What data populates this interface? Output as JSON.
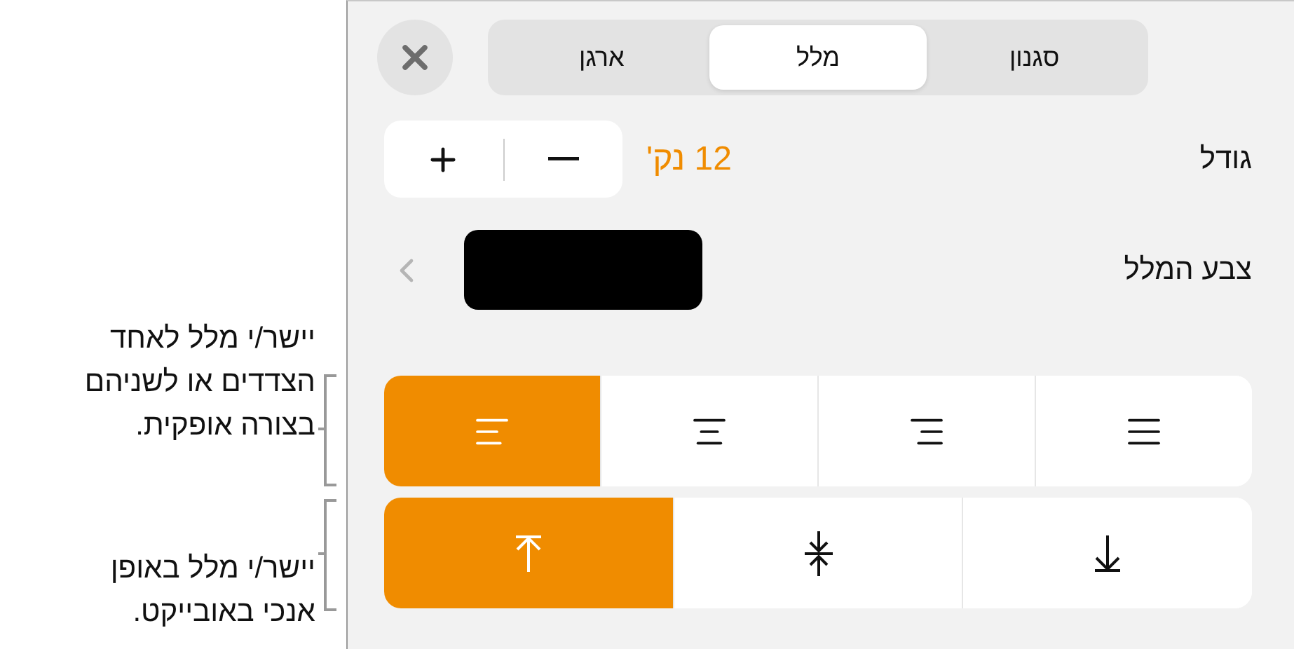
{
  "callouts": [
    {
      "lines": [
        "יישר/י מלל לאחד",
        "הצדדים או לשניהם",
        "בצורה אופקית."
      ]
    },
    {
      "lines": [
        "יישר/י מלל באופן",
        "אנכי באובייקט."
      ]
    }
  ],
  "tabs": [
    {
      "label": "סגנון",
      "selected": false
    },
    {
      "label": "מלל",
      "selected": true
    },
    {
      "label": "ארגן",
      "selected": false
    }
  ],
  "size": {
    "label": "גודל",
    "value": "12 נק'"
  },
  "text_color": {
    "label": "צבע המלל",
    "color": "#000000"
  },
  "horizontal_alignment": [
    {
      "kind": "left",
      "selected": true
    },
    {
      "kind": "center",
      "selected": false
    },
    {
      "kind": "right",
      "selected": false
    },
    {
      "kind": "justify",
      "selected": false
    }
  ],
  "vertical_alignment": [
    {
      "kind": "top",
      "selected": true
    },
    {
      "kind": "middle",
      "selected": false
    },
    {
      "kind": "bottom",
      "selected": false
    }
  ]
}
